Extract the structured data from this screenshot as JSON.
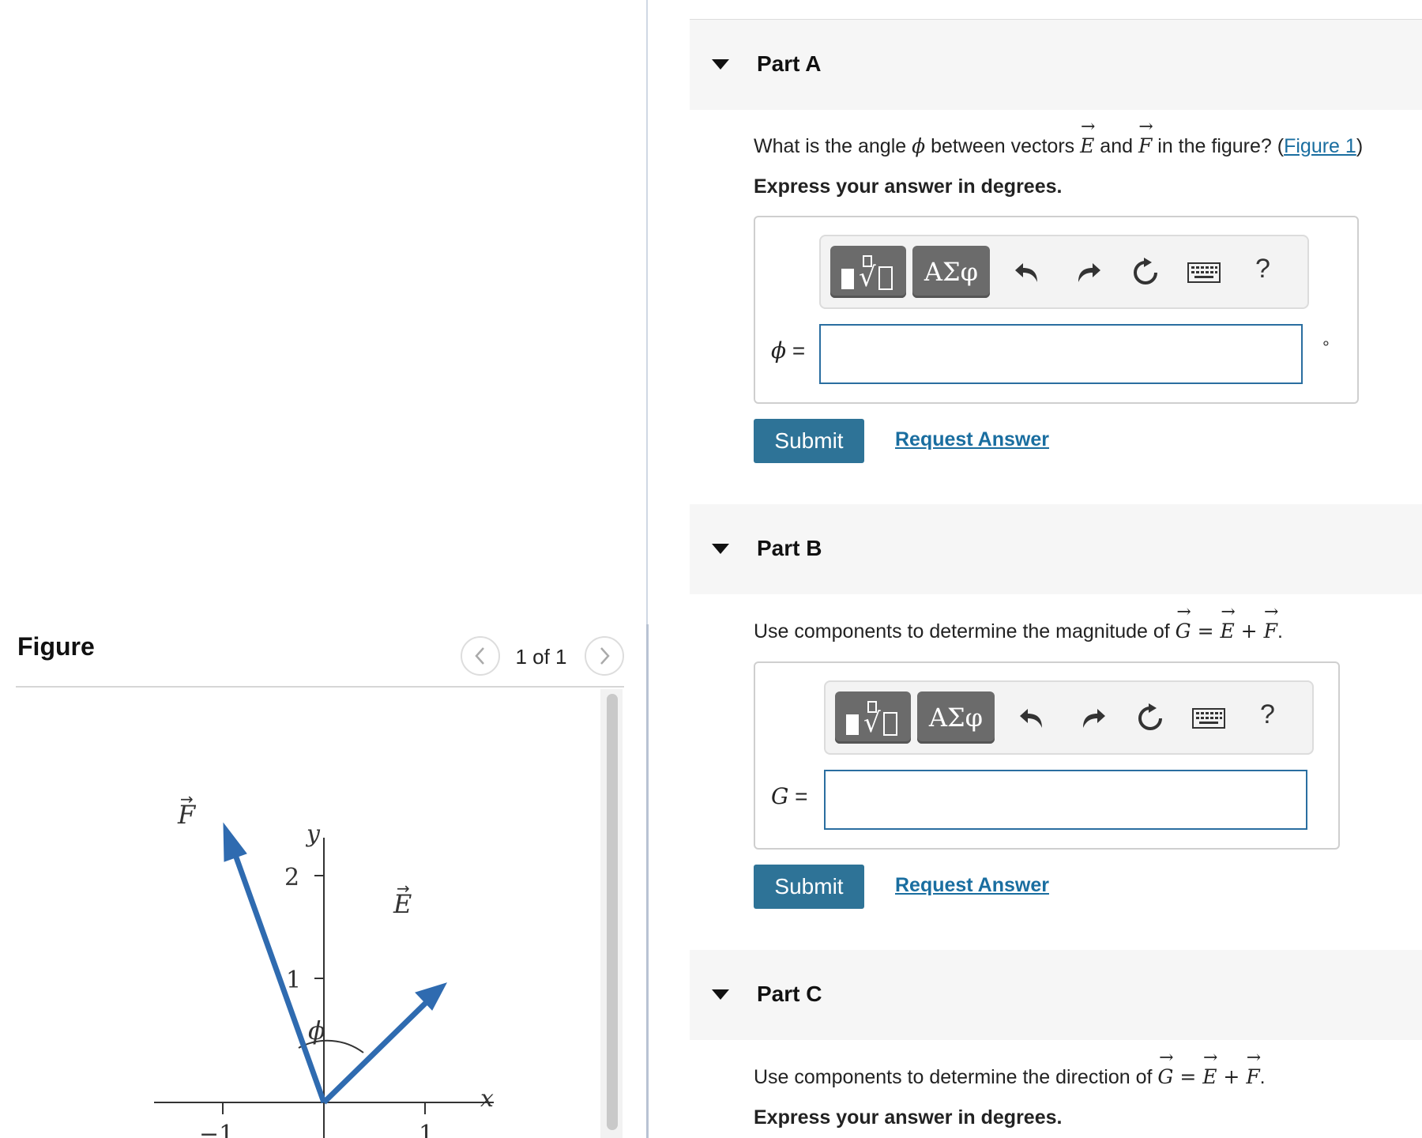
{
  "figure": {
    "title": "Figure",
    "page_indicator": "1 of 1",
    "labels": {
      "y_axis": "y",
      "x_axis": "x",
      "tick_y2": "2",
      "tick_y1": "1",
      "tick_xm1": "−1",
      "tick_x1": "1",
      "vector_f": "F",
      "vector_e": "E",
      "angle": "ϕ"
    },
    "colors": {
      "vector": "#2f6bb0",
      "axis": "#333333"
    }
  },
  "parts": [
    {
      "title": "Part A",
      "question_prefix": "What is the angle ",
      "question_var": "ϕ",
      "question_mid1": " between vectors ",
      "question_vec1": "E",
      "question_mid2": " and ",
      "question_vec2": "F",
      "question_suffix": " in the figure? (",
      "figure_link": "Figure 1",
      "question_close": ")",
      "instruction": "Express your answer in degrees.",
      "variable": "ϕ",
      "equals": "=",
      "input_value": "",
      "unit": "°",
      "submit": "Submit",
      "request": "Request Answer"
    },
    {
      "title": "Part B",
      "question_prefix": "Use components to determine the magnitude of ",
      "eq_g": "G",
      "eq_eq": " = ",
      "eq_e": "E",
      "eq_plus": " + ",
      "eq_f": "F",
      "eq_end": ".",
      "variable": "G",
      "equals": "=",
      "input_value": "",
      "submit": "Submit",
      "request": "Request Answer"
    },
    {
      "title": "Part C",
      "question_prefix": "Use components to determine the direction of ",
      "eq_g": "G",
      "eq_eq": " = ",
      "eq_e": "E",
      "eq_plus": " + ",
      "eq_f": "F",
      "eq_end": ".",
      "instruction": "Express your answer in degrees."
    }
  ],
  "toolbar": {
    "symbols_label": "ΑΣφ",
    "help_label": "?",
    "icons": [
      "templates-icon",
      "undo-icon",
      "redo-icon",
      "reset-icon",
      "keyboard-icon",
      "help-icon"
    ]
  }
}
